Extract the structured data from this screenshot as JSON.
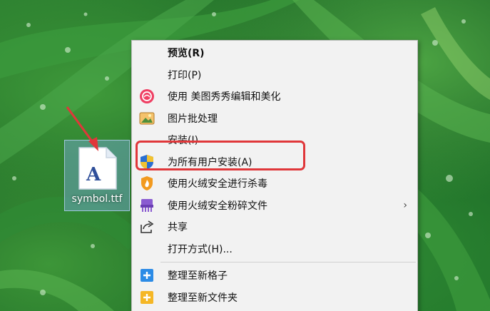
{
  "desktop": {
    "file_name": "symbol.ttf"
  },
  "context_menu": {
    "items": [
      {
        "label": "预览(R)",
        "icon": "none",
        "bold": true
      },
      {
        "label": "打印(P)",
        "icon": "none"
      },
      {
        "label": "使用 美图秀秀编辑和美化",
        "icon": "meitu-icon"
      },
      {
        "label": "图片批处理",
        "icon": "image-batch-icon"
      },
      {
        "label": "安装(I)",
        "icon": "none"
      },
      {
        "label": "为所有用户安装(A)",
        "icon": "uac-shield-icon"
      },
      {
        "label": "使用火绒安全进行杀毒",
        "icon": "huorong-antivirus-icon"
      },
      {
        "label": "使用火绒安全粉碎文件",
        "icon": "huorong-shredder-icon",
        "submenu_arrow": "›"
      },
      {
        "label": "共享",
        "icon": "share-icon"
      },
      {
        "label": "打开方式(H)...",
        "icon": "none"
      },
      {
        "label": "整理至新格子",
        "icon": "fences-grid-icon"
      },
      {
        "label": "整理至新文件夹",
        "icon": "fences-folder-icon"
      }
    ]
  },
  "colors": {
    "highlight_border": "#e0373a",
    "menu_bg": "#f2f2f2",
    "selection_bg": "#7aaee0"
  }
}
